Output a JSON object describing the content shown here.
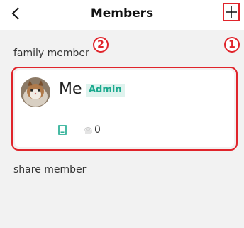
{
  "header": {
    "title": "Members",
    "back_icon": "chevron-left-icon",
    "add_icon": "plus-icon"
  },
  "annotations": {
    "marker_1": "1",
    "marker_2": "2"
  },
  "sections": {
    "family_label": "family member",
    "share_label": "share member"
  },
  "member": {
    "name": "Me",
    "role": "Admin",
    "fingerprint_count": "0",
    "device_icon": "phone-icon",
    "fingerprint_icon": "fingerprint-icon"
  },
  "colors": {
    "accent": "#1aa98e",
    "annotation": "#e0242b",
    "background": "#f2f2f2"
  }
}
